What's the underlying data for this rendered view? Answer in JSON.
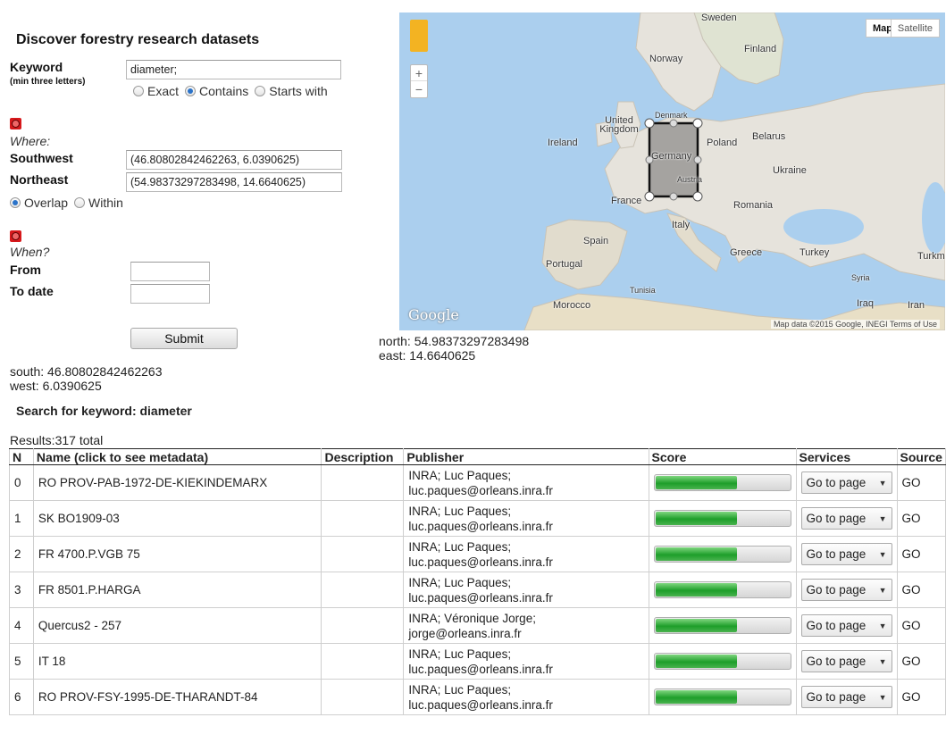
{
  "form": {
    "title": "Discover forestry research datasets",
    "keyword_label": "Keyword",
    "keyword_hint": "(min three letters)",
    "keyword_value": "diameter;",
    "match_options": [
      "Exact",
      "Contains",
      "Starts with"
    ],
    "match_selected": "Contains",
    "where_label": "Where:",
    "southwest_label": "Southwest",
    "southwest_value": "(46.80802842462263, 6.0390625)",
    "northeast_label": "Northeast",
    "northeast_value": "(54.98373297283498, 14.6640625)",
    "spatial_options": [
      "Overlap",
      "Within"
    ],
    "spatial_selected": "Overlap",
    "when_label": "When?",
    "from_label": "From",
    "from_value": "",
    "to_label": "To date",
    "to_value": "",
    "submit_label": "Submit",
    "remove_icon": "close-icon"
  },
  "map": {
    "type_options": [
      "Map",
      "Satellite"
    ],
    "type_selected": "Map",
    "zoom_in": "+",
    "zoom_out": "−",
    "labels": [
      "Sweden",
      "Finland",
      "Norway",
      "Denmark",
      "United Kingdom",
      "Ireland",
      "Belarus",
      "Poland",
      "Germany",
      "Austria",
      "Ukraine",
      "France",
      "Romania",
      "Italy",
      "Spain",
      "Portugal",
      "Greece",
      "Turkey",
      "Turkm",
      "Syria",
      "Iraq",
      "Iran",
      "Tunisia",
      "Morocco"
    ],
    "logo": "Google",
    "attribution": "Map data ©2015 Google, INEGI   Terms of Use",
    "colors": {
      "water": "#abcfee",
      "land": "#e6e3dc",
      "selection": "#6f6f6f"
    }
  },
  "bounds": {
    "north": "north: 54.98373297283498",
    "east": "east: 14.6640625",
    "south": "south: 46.80802842462263",
    "west": "west: 6.0390625"
  },
  "search_heading": "Search for keyword: diameter",
  "results_summary": "Results:317 total",
  "table": {
    "headers": [
      "N",
      "Name (click to see metadata)",
      "Description",
      "Publisher",
      "Score",
      "Services",
      "Source"
    ],
    "rows": [
      {
        "n": "0",
        "name": "RO PROV-PAB-1972-DE-KIEKINDEMARX",
        "description": "",
        "publisher_1": "INRA; Luc Paques;",
        "publisher_2": "luc.paques@orleans.inra.fr",
        "score": 0.6,
        "service": "Go to page",
        "source": "GO"
      },
      {
        "n": "1",
        "name": "SK BO1909-03",
        "description": "",
        "publisher_1": "INRA; Luc Paques;",
        "publisher_2": "luc.paques@orleans.inra.fr",
        "score": 0.6,
        "service": "Go to page",
        "source": "GO"
      },
      {
        "n": "2",
        "name": "FR 4700.P.VGB 75",
        "description": "",
        "publisher_1": "INRA; Luc Paques;",
        "publisher_2": "luc.paques@orleans.inra.fr",
        "score": 0.6,
        "service": "Go to page",
        "source": "GO"
      },
      {
        "n": "3",
        "name": "FR 8501.P.HARGA",
        "description": "",
        "publisher_1": "INRA; Luc Paques;",
        "publisher_2": "luc.paques@orleans.inra.fr",
        "score": 0.6,
        "service": "Go to page",
        "source": "GO"
      },
      {
        "n": "4",
        "name": "Quercus2 - 257",
        "description": "",
        "publisher_1": "INRA; Véronique Jorge;",
        "publisher_2": "jorge@orleans.inra.fr",
        "score": 0.6,
        "service": "Go to page",
        "source": "GO"
      },
      {
        "n": "5",
        "name": "IT 18",
        "description": "",
        "publisher_1": "INRA; Luc Paques;",
        "publisher_2": "luc.paques@orleans.inra.fr",
        "score": 0.6,
        "service": "Go to page",
        "source": "GO"
      },
      {
        "n": "6",
        "name": "RO PROV-FSY-1995-DE-THARANDT-84",
        "description": "",
        "publisher_1": "INRA; Luc Paques;",
        "publisher_2": "luc.paques@orleans.inra.fr",
        "score": 0.6,
        "service": "Go to page",
        "source": "GO"
      }
    ]
  }
}
